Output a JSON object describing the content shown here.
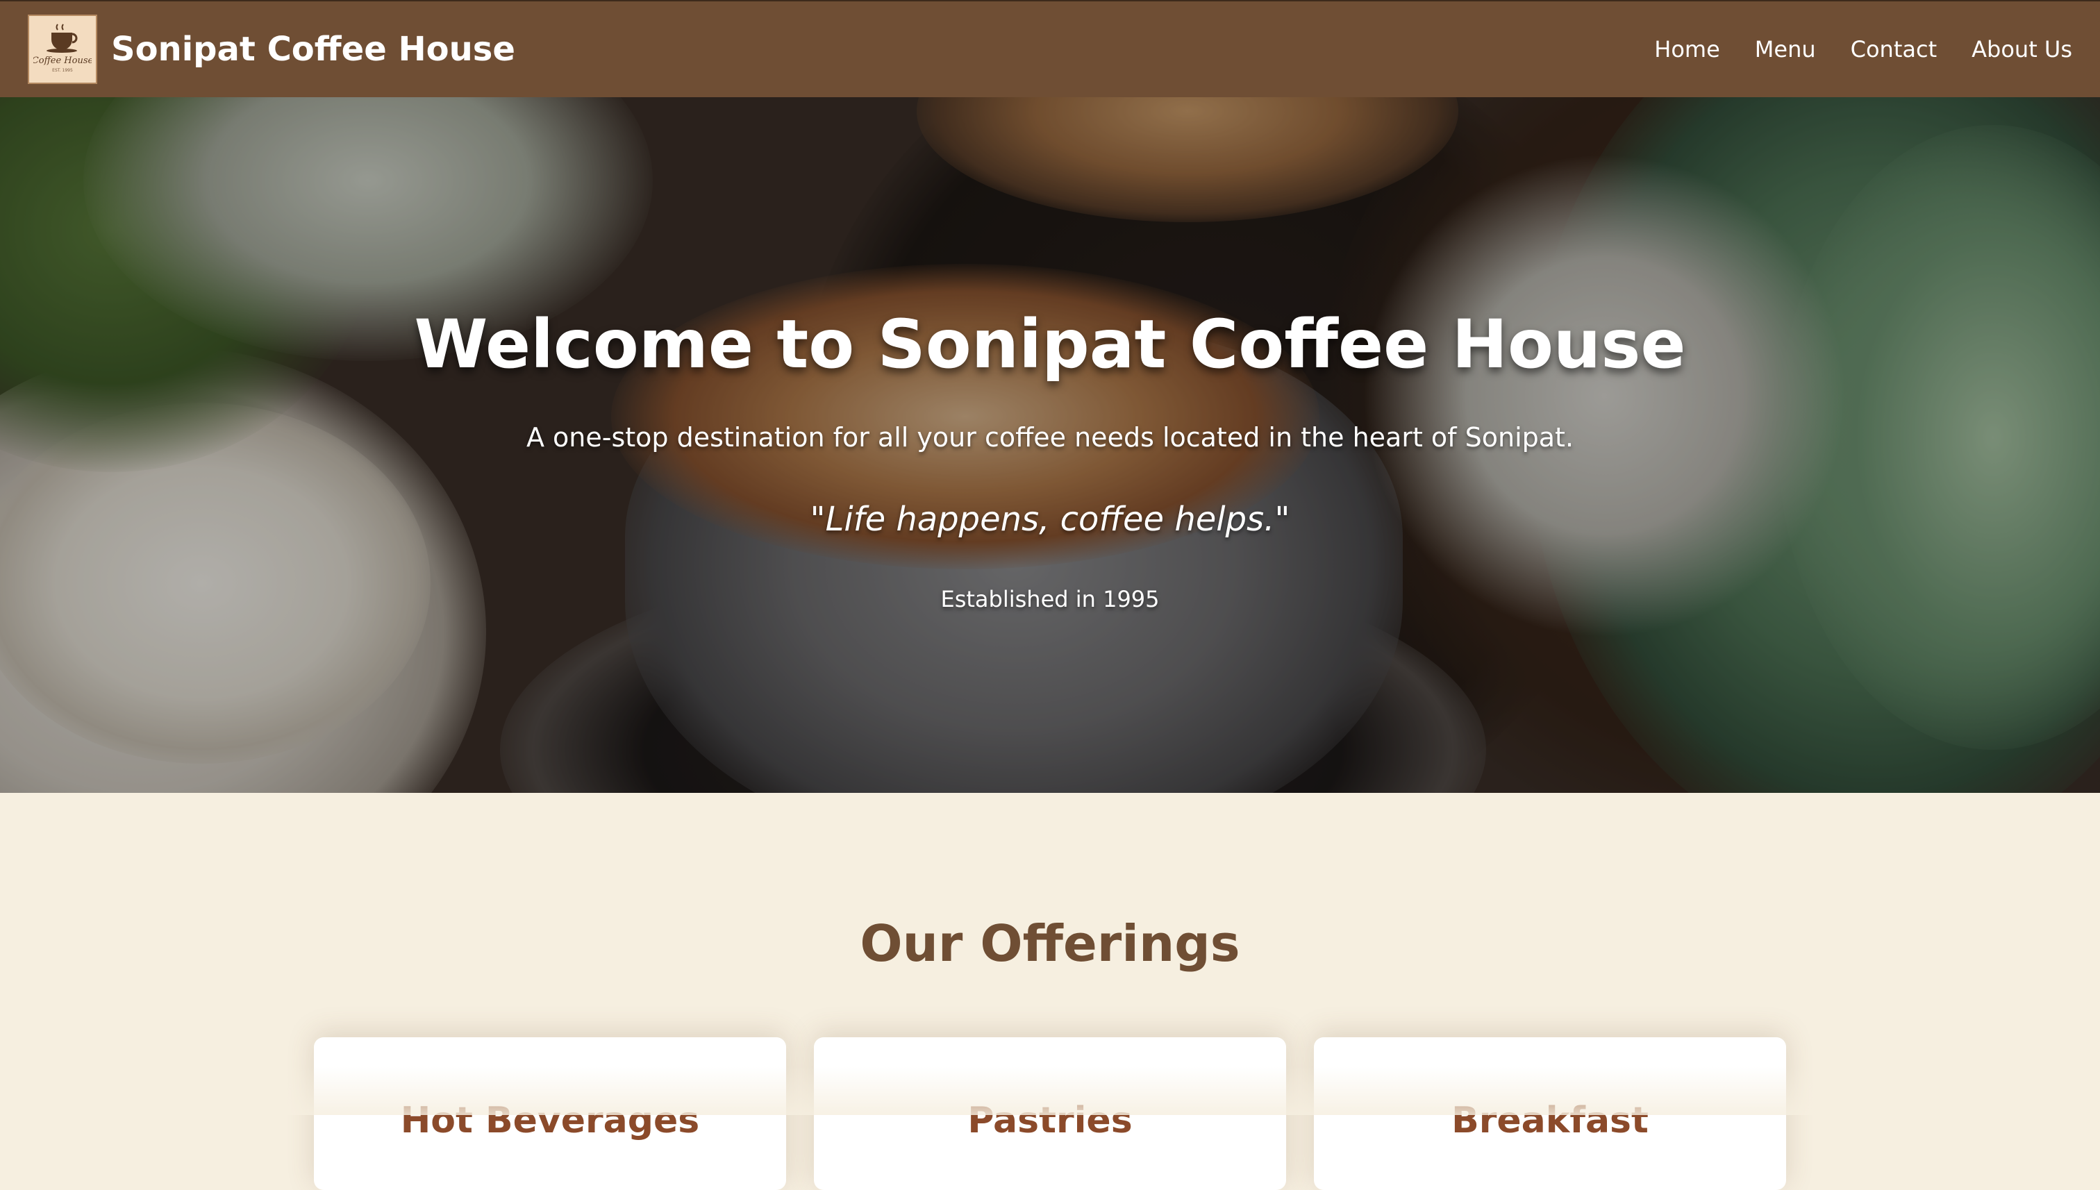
{
  "navbar": {
    "logo": {
      "icon": "coffee-cup-logo",
      "text": "Coffee House",
      "tagline": "EST. 1995"
    },
    "brand": "Sonipat Coffee House",
    "links": [
      {
        "label": "Home"
      },
      {
        "label": "Menu"
      },
      {
        "label": "Contact"
      },
      {
        "label": "About Us"
      }
    ]
  },
  "hero": {
    "title": "Welcome to Sonipat Coffee House",
    "subtitle": "A one-stop destination for all your coffee needs located in the heart of Sonipat.",
    "quote": "\"Life happens, coffee helps.\"",
    "established": "Established in 1995"
  },
  "offerings": {
    "title": "Our Offerings",
    "cards": [
      {
        "title": "Hot Beverages"
      },
      {
        "title": "Pastries"
      },
      {
        "title": "Breakfast"
      }
    ]
  },
  "colors": {
    "navbar": "#6f4e34",
    "accent": "#6f4e34",
    "card_title": "#8b4a2a",
    "section_bg": "#f6efe0"
  }
}
